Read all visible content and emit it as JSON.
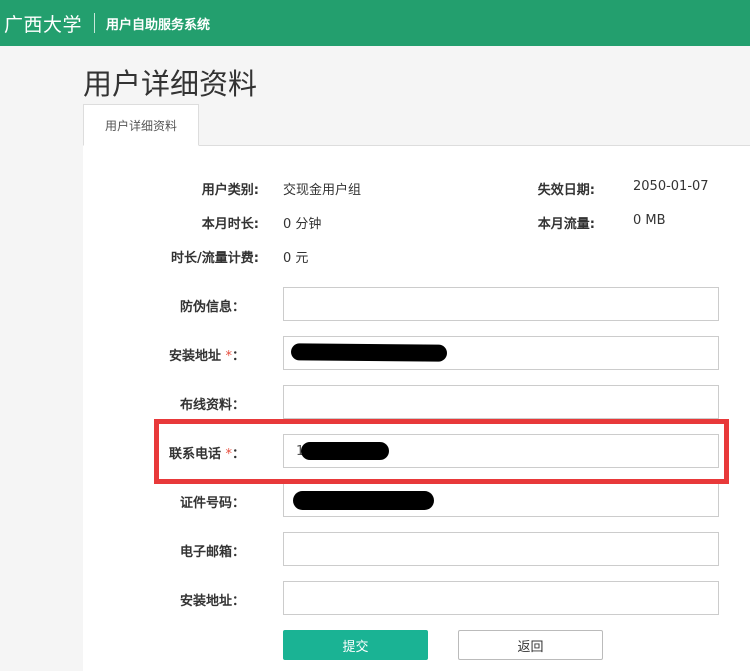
{
  "header": {
    "brand": "广西大学",
    "subtitle": "用户自助服务系统"
  },
  "page": {
    "title": "用户详细资料",
    "tab_label": "用户详细资料"
  },
  "info": {
    "user_type_label": "用户类别:",
    "user_type_value": "交现金用户组",
    "expire_label": "失效日期:",
    "expire_value": "2050-01-07",
    "month_time_label": "本月时长:",
    "month_time_value": "0 分钟",
    "month_traffic_label": "本月流量:",
    "month_traffic_value": "0 MB",
    "fee_label": "时长/流量计费:",
    "fee_value": "0 元"
  },
  "form": {
    "anti_fake_label": "防伪信息",
    "install_addr_label": "安装地址",
    "wiring_label": "布线资料",
    "phone_label": "联系电话",
    "phone_value_visible": "1",
    "id_number_label": "证件号码",
    "email_label": "电子邮箱",
    "install_addr2_label": "安装地址",
    "required_mark": "*",
    "colon": "："
  },
  "buttons": {
    "submit": "提交",
    "back": "返回"
  },
  "colors": {
    "header_bg": "#239f6e",
    "submit_bg": "#1ab394",
    "highlight": "#e8393a",
    "required": "#e74c3c"
  }
}
